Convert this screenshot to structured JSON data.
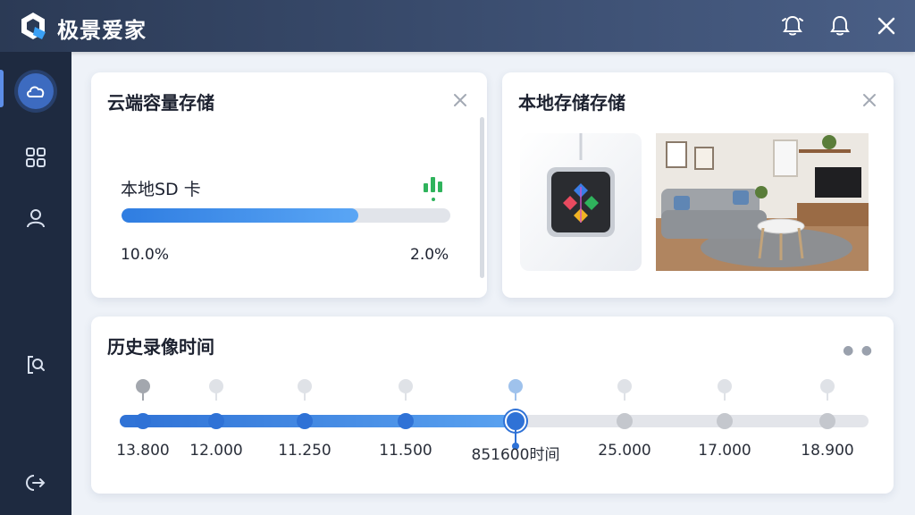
{
  "app": {
    "title": "极景爱家"
  },
  "colors": {
    "accent": "#2f7de1",
    "sidebar": "#1e2a40",
    "topbar": "#2b3a55",
    "green_signal": "#2fb35c"
  },
  "topbar": {
    "icons": [
      "alarm-bell-icon",
      "bell-icon",
      "close-icon"
    ]
  },
  "sidebar": {
    "items": [
      "cloud-icon",
      "apps-grid-icon",
      "user-icon",
      "search-document-icon",
      "logout-icon"
    ],
    "active": "cloud-icon"
  },
  "cloud_card": {
    "title": "云端容量存储",
    "storage_label": "本地SD 卡",
    "progress_fraction": 0.72,
    "left_value": "10.0%",
    "right_value": "2.0%",
    "signal_icon": "signal-bars-icon"
  },
  "local_card": {
    "title": "本地存储存储",
    "images": [
      "storage-device-image",
      "living-room-photo"
    ]
  },
  "history_card": {
    "title": "历史录像时间",
    "more_icon": "more-dots-icon",
    "selected_index": 4,
    "points": [
      {
        "label": "13.800"
      },
      {
        "label": "12.000"
      },
      {
        "label": "11.250"
      },
      {
        "label": "11.500"
      },
      {
        "label": "851600时间"
      },
      {
        "label": "25.000"
      },
      {
        "label": "17.000"
      },
      {
        "label": "18.900"
      }
    ]
  }
}
